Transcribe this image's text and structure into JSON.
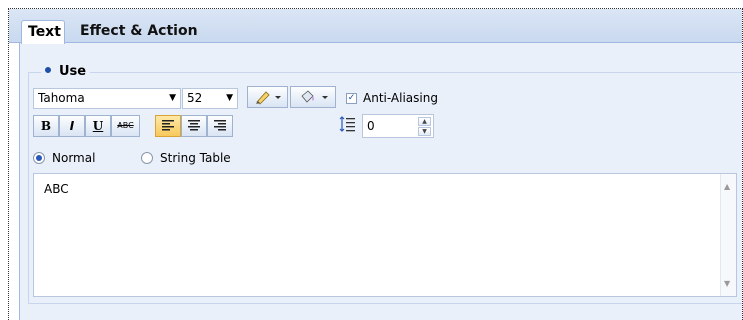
{
  "tabs": [
    {
      "label": "Text",
      "active": true
    },
    {
      "label": "Effect & Action",
      "active": false
    }
  ],
  "group": {
    "title": "Use"
  },
  "font": {
    "family": "Tahoma",
    "size": "52"
  },
  "style_buttons": {
    "bold": "B",
    "italic": "I",
    "underline": "U",
    "strike": "ABC"
  },
  "alignment": {
    "selected": "left"
  },
  "anti_aliasing": {
    "label": "Anti-Aliasing",
    "checked": true
  },
  "line_spacing": {
    "value": "0"
  },
  "source": {
    "options": [
      {
        "label": "Normal",
        "selected": true
      },
      {
        "label": "String Table",
        "selected": false
      }
    ]
  },
  "text_content": "ABC",
  "colors": {
    "accent": "#1e4fa8",
    "tab_strip": "#c9d9ef",
    "panel": "#e9f0fa",
    "active_align": "#f8c95c"
  }
}
